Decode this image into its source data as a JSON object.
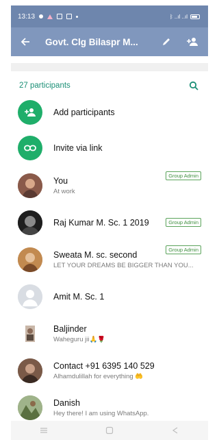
{
  "status_bar": {
    "time": "13:13",
    "right_text": "ᛒ ..ıl ..ıl"
  },
  "header": {
    "title": "Govt. Clg Bilaspr M..."
  },
  "participants": {
    "count_label": "27 participants"
  },
  "actions": [
    {
      "label": "Add participants",
      "icon": "add-person-icon"
    },
    {
      "label": "Invite via link",
      "icon": "link-icon"
    }
  ],
  "members": [
    {
      "name": "You",
      "status": "At work",
      "badge": "Group Admin",
      "avatar_color": "#8a5a4a"
    },
    {
      "name": "Raj Kumar M. Sc. 1 2019",
      "status": "",
      "badge": "Group Admin",
      "avatar_color": "#2a2a2a"
    },
    {
      "name": "Sweata M. sc. second",
      "status": "LET YOUR DREAMS BE BIGGER THAN YOU...",
      "badge": "Group Admin",
      "avatar_color": "#b07a45"
    },
    {
      "name": "Amit M. Sc. 1",
      "status": "",
      "badge": "",
      "avatar_color": "#d9dde3"
    },
    {
      "name": "Baljinder",
      "status": "Waheguru jii🙏🌹",
      "badge": "",
      "avatar_color": "#c9b7a8"
    },
    {
      "name": "Contact +91 6395 140 529",
      "status": "Alhamdulillah for everything 🤲",
      "badge": "",
      "avatar_color": "#6b4d3d"
    },
    {
      "name": "Danish",
      "status": "Hey there! I am using WhatsApp.",
      "badge": "",
      "avatar_color": "#6f8a4e"
    }
  ],
  "colors": {
    "accent_green": "#1b8f76",
    "appbar": "#8097bd",
    "statusbar": "#6e86ad",
    "badge_border": "#5aa35a"
  }
}
